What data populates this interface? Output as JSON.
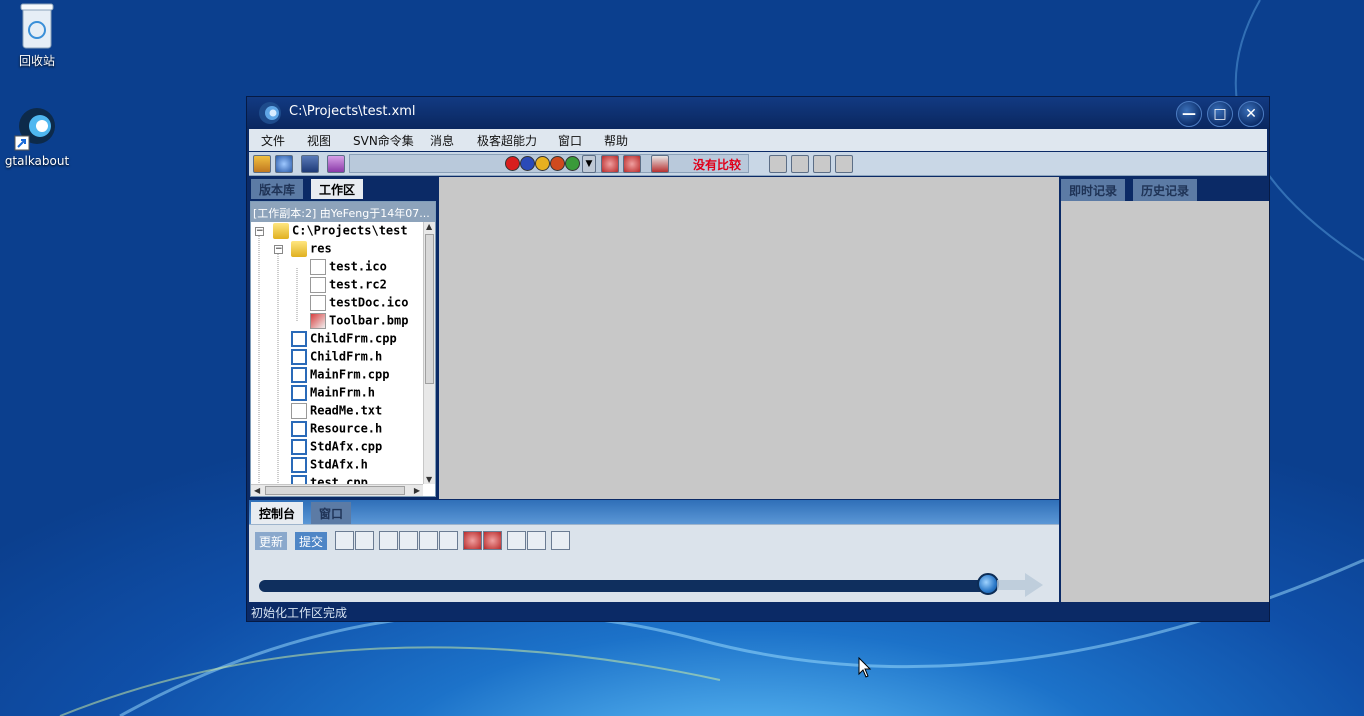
{
  "desktop": {
    "icons": [
      {
        "label": "回收站"
      },
      {
        "label": "gtalkabout"
      }
    ]
  },
  "window": {
    "title": "C:\\Projects\\test.xml",
    "controls": {
      "minimize": "—",
      "maximize": "□",
      "close": "✕"
    },
    "menu": [
      "文件",
      "视图",
      "SVN命令集",
      "消息",
      "极客超能力",
      "窗口",
      "帮助"
    ],
    "toolbar": {
      "compare_label": "没有比较"
    },
    "left_panel": {
      "tabs": [
        "版本库",
        "工作区"
      ],
      "header": "[工作副本:2] 由YeFeng于14年07...",
      "tree": [
        {
          "label": "C:\\Projects\\test"
        },
        {
          "label": "res"
        },
        {
          "label": "test.ico"
        },
        {
          "label": "test.rc2"
        },
        {
          "label": "testDoc.ico"
        },
        {
          "label": "Toolbar.bmp"
        },
        {
          "label": "ChildFrm.cpp"
        },
        {
          "label": "ChildFrm.h"
        },
        {
          "label": "MainFrm.cpp"
        },
        {
          "label": "MainFrm.h"
        },
        {
          "label": "ReadMe.txt"
        },
        {
          "label": "Resource.h"
        },
        {
          "label": "StdAfx.cpp"
        },
        {
          "label": "StdAfx.h"
        },
        {
          "label": "test.cpp"
        }
      ]
    },
    "right_panel": {
      "tabs": [
        "即时记录",
        "历史记录"
      ]
    },
    "bottom": {
      "tabs": [
        "控制台",
        "窗口"
      ],
      "buttons": {
        "update": "更新",
        "commit": "提交"
      },
      "progress_percent": 100
    },
    "status": "初始化工作区完成"
  },
  "colors": {
    "accent_red": "#e0001a",
    "window_frame": "#0b2a66",
    "svn_ok_green": "#3fae2a"
  }
}
